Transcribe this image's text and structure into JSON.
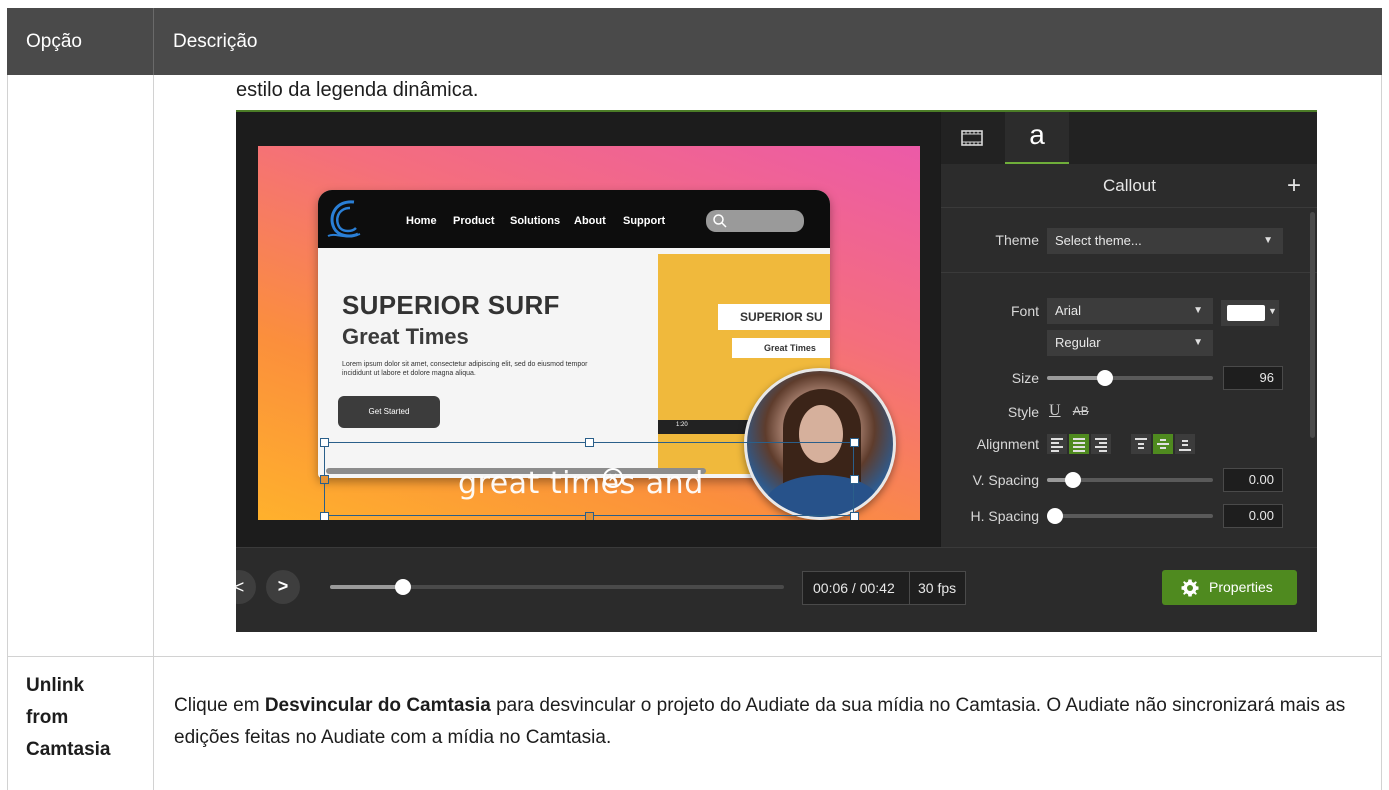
{
  "table": {
    "headers": [
      "Opção",
      "Descrição"
    ],
    "row1": {
      "caption": "estilo da legenda dinâmica."
    },
    "row2": {
      "label_lines": [
        "Unlink",
        "from",
        "Camtasia"
      ],
      "text_before": "Clique em ",
      "text_bold": "Desvincular do Camtasia",
      "text_after": " para desvincular o projeto do Audiate da sua mídia no Camtasia. O Audiate não sincronizará mais as edições feitas no Audiate com a mídia no Camtasia."
    }
  },
  "screenshot": {
    "website": {
      "nav_links": [
        "Home",
        "Product",
        "Solutions",
        "About",
        "Support"
      ],
      "headline": "SUPERIOR SURF",
      "subheadline": "Great Times",
      "body": "Lorem ipsum dolor sit amet, consectetur adipiscing elit, sed do eiusmod tempor incididunt ut labore et dolore magna aliqua.",
      "cta": "Get Started",
      "card_title": "SUPERIOR SU",
      "card_subtitle": "Great Times",
      "video_time": "1:20"
    },
    "caption_text": "great times and",
    "transport": {
      "back": "<",
      "forward": ">",
      "progress": 0.16,
      "timecode": "00:06 / 00:42",
      "fps": "30 fps",
      "properties_label": "Properties"
    },
    "panel": {
      "tab_text": "a",
      "title": "Callout",
      "plus": "+",
      "theme_label": "Theme",
      "theme_value": "Select theme...",
      "font_label": "Font",
      "font_value": "Arial",
      "weight_value": "Regular",
      "size_label": "Size",
      "size_value": "96",
      "style_label": "Style",
      "style_underline": "U",
      "style_strike": "AB",
      "alignment_label": "Alignment",
      "vspacing_label": "V. Spacing",
      "vspacing_value": "0.00",
      "hspacing_label": "H. Spacing",
      "hspacing_value": "0.00",
      "font_color": "#ffffff",
      "accent": "#4f8a1f"
    }
  }
}
